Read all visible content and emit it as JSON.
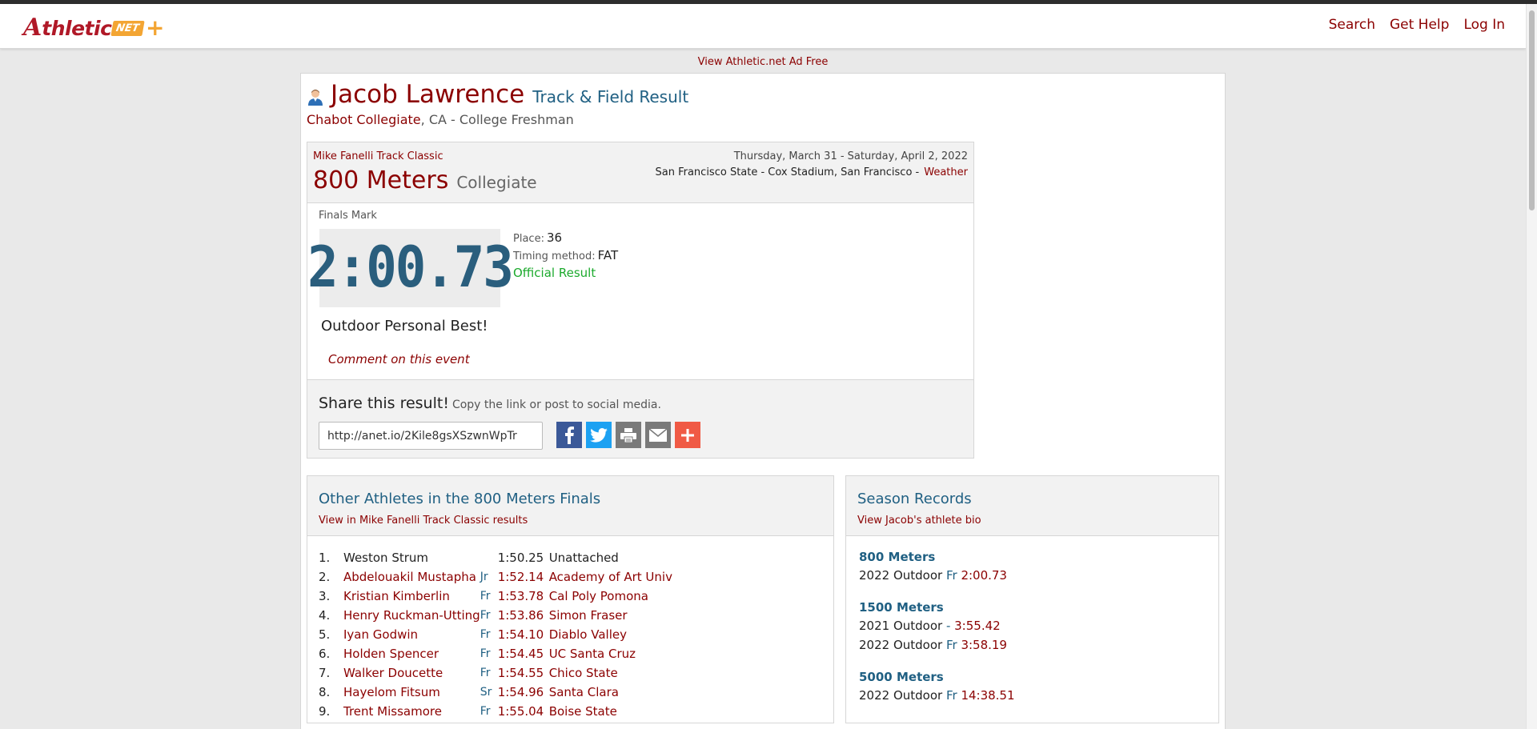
{
  "navbar": {
    "logo_a": "A",
    "logo_thletic": "thletic",
    "logo_net": "NET",
    "logo_plus": "+",
    "links": [
      "Search",
      "Get Help",
      "Log In"
    ]
  },
  "ad_free_link": "View Athletic.net Ad Free",
  "athlete": {
    "name": "Jacob Lawrence",
    "result_type": "Track & Field Result",
    "school": "Chabot Collegiate",
    "school_suffix": ", CA - College Freshman"
  },
  "meet": {
    "name": "Mike Fanelli Track Classic",
    "event": "800 Meters",
    "division": "Collegiate",
    "date": "Thursday, March 31 - Saturday, April 2, 2022",
    "location": "San Francisco State - Cox Stadium, San Francisco -",
    "weather_link": "Weather"
  },
  "result": {
    "finals_label": "Finals Mark",
    "mark": "2:00.73",
    "place_label": "Place:",
    "place": "36",
    "timing_label": "Timing method:",
    "timing": "FAT",
    "official": "Official Result",
    "personal_best": "Outdoor Personal Best!",
    "comment_link": "Comment on this event"
  },
  "share": {
    "title": "Share this result!",
    "subtitle": "Copy the link or post to social media.",
    "url": "http://anet.io/2Kile8gsXSzwnWpTr",
    "icons": [
      "facebook-icon",
      "twitter-icon",
      "print-icon",
      "email-icon",
      "add-icon"
    ]
  },
  "others": {
    "title": "Other Athletes in the 800 Meters Finals",
    "link": "View in Mike Fanelli Track Classic results",
    "rows": [
      {
        "place": "1.",
        "name": "Weston Strum",
        "grade": "",
        "time": "1:50.25",
        "school": "Unattached",
        "linked": false
      },
      {
        "place": "2.",
        "name": "Abdelouakil Mustapha",
        "grade": "Jr",
        "time": "1:52.14",
        "school": "Academy of Art Univ",
        "linked": true
      },
      {
        "place": "3.",
        "name": "Kristian Kimberlin",
        "grade": "Fr",
        "time": "1:53.78",
        "school": "Cal Poly Pomona",
        "linked": true
      },
      {
        "place": "4.",
        "name": "Henry Ruckman-Utting",
        "grade": "Fr",
        "time": "1:53.86",
        "school": "Simon Fraser",
        "linked": true
      },
      {
        "place": "5.",
        "name": "Iyan Godwin",
        "grade": "Fr",
        "time": "1:54.10",
        "school": "Diablo Valley",
        "linked": true
      },
      {
        "place": "6.",
        "name": "Holden Spencer",
        "grade": "Fr",
        "time": "1:54.45",
        "school": "UC Santa Cruz",
        "linked": true
      },
      {
        "place": "7.",
        "name": "Walker Doucette",
        "grade": "Fr",
        "time": "1:54.55",
        "school": "Chico State",
        "linked": true
      },
      {
        "place": "8.",
        "name": "Hayelom Fitsum",
        "grade": "Sr",
        "time": "1:54.96",
        "school": "Santa Clara",
        "linked": true
      },
      {
        "place": "9.",
        "name": "Trent Missamore",
        "grade": "Fr",
        "time": "1:55.04",
        "school": "Boise State",
        "linked": true
      }
    ]
  },
  "records": {
    "title": "Season Records",
    "link": "View Jacob's athlete bio",
    "groups": [
      {
        "event": "800 Meters",
        "rows": [
          {
            "season": "2022 Outdoor",
            "grade": "Fr",
            "time": "2:00.73"
          }
        ]
      },
      {
        "event": "1500 Meters",
        "rows": [
          {
            "season": "2021 Outdoor",
            "grade": "-",
            "time": "3:55.42"
          },
          {
            "season": "2022 Outdoor",
            "grade": "Fr",
            "time": "3:58.19"
          }
        ]
      },
      {
        "event": "5000 Meters",
        "rows": [
          {
            "season": "2022 Outdoor",
            "grade": "Fr",
            "time": "14:38.51"
          }
        ]
      }
    ]
  }
}
